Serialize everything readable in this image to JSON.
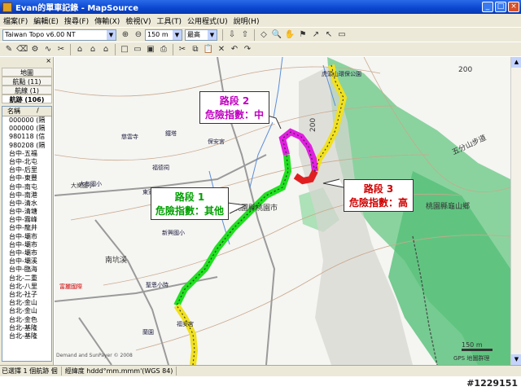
{
  "window": {
    "title": "Evan的單車記錄 - MapSource"
  },
  "menu": [
    "檔案(F)",
    "編輯(E)",
    "搜尋(F)",
    "傳輸(X)",
    "檢視(V)",
    "工具(T)",
    "公用程式(U)",
    "說明(H)"
  ],
  "toolbar": {
    "map_product": "Taiwan Topo v6.00 NT",
    "zoom_scale": "150 m",
    "detail_level": "最高"
  },
  "sidebar": {
    "tabs": [
      "地圖",
      "航點 (11)",
      "航線 (1)",
      "航跡 (106)"
    ],
    "list_header": [
      "名稱"
    ],
    "items": [
      "000000 (隔",
      "000000 (隔",
      "980118 (信",
      "980208 (隔",
      "台中-五福",
      "台中-北屯",
      "台中-后里",
      "台中-東豐",
      "台中-南屯",
      "台中-南港",
      "台中-清水",
      "台中-清塘",
      "台中-霧峰",
      "台中-龍井",
      "台中-壩市",
      "台中-壩市",
      "台中-壩市",
      "台中-壩溪",
      "台中-臨海",
      "台北-二重",
      "台北-八里",
      "台北-社子",
      "台北-金山",
      "台北-金山",
      "台北-金色",
      "台北-基隆",
      "台北-基隆"
    ]
  },
  "map": {
    "labels": [
      "桃園縣桃園市",
      "桃園縣龜山鄉",
      "五分山步道",
      "南坑溪",
      "大崗國小",
      "200",
      "200",
      "150 m"
    ],
    "pois": [
      "虎頭山環保公園",
      "慈雲寺",
      "鐵塔",
      "保安宮",
      "福德祠",
      "大有國小",
      "東家公園",
      "富麗國際",
      "新興國小",
      "聖恩小時",
      "蘭園",
      "福安宮"
    ],
    "credit": "Demand and SunPayer © 2008",
    "copyright": "GPS 地圖群理",
    "callouts": [
      {
        "title": "路段 2",
        "risk": "危險指數：中",
        "color": "#c000c0"
      },
      {
        "title": "路段 1",
        "risk": "危險指數：其他",
        "color": "#00a000"
      },
      {
        "title": "路段 3",
        "risk": "危險指數：高",
        "color": "#d00000"
      }
    ]
  },
  "statusbar": {
    "selection": "已選擇 1 個航跡 個",
    "coord_format": "經緯度 hddd°mm.mmm'(WGS 84)"
  },
  "watermark": "#1229151"
}
